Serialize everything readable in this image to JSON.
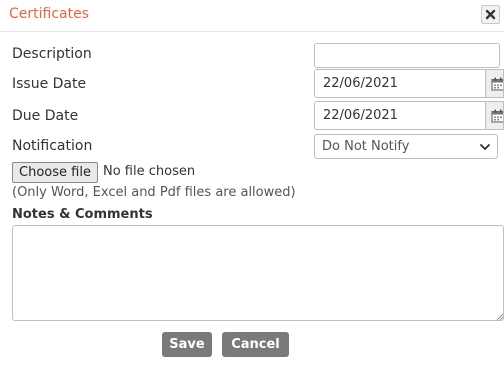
{
  "dialog": {
    "title": "Certificates",
    "close_icon": "close-icon"
  },
  "form": {
    "description": {
      "label": "Description",
      "value": ""
    },
    "issue_date": {
      "label": "Issue Date",
      "value": "22/06/2021",
      "icon": "calendar-icon"
    },
    "due_date": {
      "label": "Due Date",
      "value": "22/06/2021",
      "icon": "calendar-icon"
    },
    "notification": {
      "label": "Notification",
      "selected": "Do Not Notify",
      "icon": "chevron-down-icon"
    },
    "file": {
      "button_label": "Choose file",
      "status": "No file chosen",
      "hint": "(Only Word, Excel and Pdf files are allowed)"
    },
    "notes": {
      "label": "Notes & Comments",
      "value": ""
    }
  },
  "actions": {
    "save_label": "Save",
    "cancel_label": "Cancel"
  },
  "colors": {
    "title": "#f0643c",
    "button_bg": "#7a7a7a",
    "border": "#bfbfbf"
  }
}
